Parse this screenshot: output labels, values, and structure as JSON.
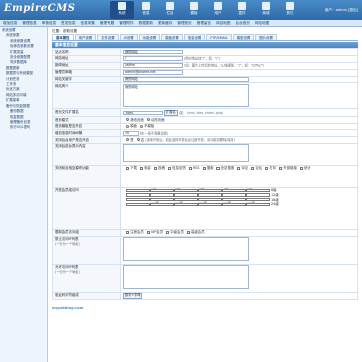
{
  "app": {
    "logo": "EmpireCMS",
    "user_label": "用户：admin [退出]"
  },
  "nav": [
    {
      "label": "系统",
      "icon": "system-icon",
      "active": true
    },
    {
      "label": "信息",
      "icon": "info-icon"
    },
    {
      "label": "栏目",
      "icon": "column-icon"
    },
    {
      "label": "模板",
      "icon": "template-icon"
    },
    {
      "label": "用户",
      "icon": "user-icon"
    },
    {
      "label": "插件",
      "icon": "plugin-icon"
    },
    {
      "label": "商城",
      "icon": "shop-icon"
    },
    {
      "label": "其它",
      "icon": "other-icon"
    }
  ],
  "subnav": [
    "增加信息",
    "管理信息",
    "审核信息",
    "签发信息",
    "信息采集",
    "管理专题",
    "管理附件",
    "数据更新",
    "更新缓存",
    "管理首页",
    "管理留言",
    "网站地图",
    "后台首页",
    "网站地图"
  ],
  "sidebar": [
    {
      "t": "系统设置",
      "l": "l1"
    },
    {
      "t": "系统参数",
      "l": "l2"
    },
    {
      "t": "系统参数设置",
      "l": "l3"
    },
    {
      "t": "伪静态参数设置",
      "l": "l3"
    },
    {
      "t": "扩展变量",
      "l": "l3"
    },
    {
      "t": "安全参数配置",
      "l": "l3"
    },
    {
      "t": "同步数据库",
      "l": "l3"
    },
    {
      "t": "数据更新",
      "l": "l2"
    },
    {
      "t": "数据表与系统模型",
      "l": "l2"
    },
    {
      "t": "计划任务",
      "l": "l2"
    },
    {
      "t": "工作流",
      "l": "l2"
    },
    {
      "t": "优化方案",
      "l": "l2"
    },
    {
      "t": "网站多访问端",
      "l": "l2"
    },
    {
      "t": "扩展菜单",
      "l": "l2"
    },
    {
      "t": "备份与恢复数据",
      "l": "l2"
    },
    {
      "t": "备份数据",
      "l": "l3"
    },
    {
      "t": "恢复数据",
      "l": "l3"
    },
    {
      "t": "管理备份目录",
      "l": "l3"
    },
    {
      "t": "执行SQL语句",
      "l": "l3"
    }
  ],
  "crumb": "位置：参数设置",
  "tabs": [
    "基本属性",
    "用户设置",
    "文件设置",
    "JS设置",
    "功能设置",
    "模板设置",
    "信息设置",
    "FTP/EMAIL",
    "模型设置",
    "图片设置"
  ],
  "section": "基本信息设置",
  "rows": {
    "site_name": {
      "k": "站点名称",
      "v": "我的网站"
    },
    "site_url": {
      "k": "网站地址",
      "v": "/",
      "hint": "(绝对地址加\"/\"，如：\"/\")"
    },
    "news_url": {
      "k": "新闻地址",
      "v": "/d/file/",
      "hint": "(如：图片上传后的地址，以/结尾如：\"/\"，如：\"d/file/\")"
    },
    "admin_email": {
      "k": "管理员邮箱",
      "v": "admin@phome.net"
    },
    "keywords": {
      "k": "网站关键字",
      "v": "我的网站"
    },
    "description": {
      "k": "网站简介",
      "v": "我的网站"
    },
    "index_ext": {
      "k": "首页文件扩展名",
      "v": ".html",
      "sel": "扩展名",
      "hint": "(如：.html,.htm,.shtml,.php)"
    },
    "index_mode": {
      "k": "首页模式",
      "opts": [
        "静态页面",
        "动态页面"
      ]
    },
    "comment_mode": {
      "k": "首页模板是否开启",
      "opts": [
        "模板",
        "不模板"
      ]
    },
    "add_interval": {
      "k": "增加信息时间间隔",
      "v": "10",
      "hint": "秒(一般不需要设置)"
    },
    "open_register": {
      "k": "关闭后台用户是否开启",
      "opts": [
        "是",
        "否"
      ],
      "hint": "(选择开放后，如此选择开放后台注册开放，该功能将删除/保持)"
    },
    "close_msg": {
      "k": "关闭后前台提示内容"
    },
    "open_modules": {
      "k": "关闭前台相应模块功能",
      "boxes": [
        "下载",
        "电影",
        "投稿",
        "信息反馈",
        "RSS",
        "搜索",
        "全站搜索",
        "评论",
        "论坛",
        "打印",
        "外部链接",
        "统计"
      ]
    },
    "open_groups": {
      "k": "开放会员组访问",
      "items": [
        "1级",
        "2级",
        "3级",
        "4级",
        "5级",
        "6级",
        "7级",
        "8级",
        "9级",
        "10级",
        "11级",
        "12级",
        "13级",
        "14级",
        "15级",
        "16级",
        "17级",
        "18级",
        "19级",
        "20级",
        "21级",
        "22级",
        "23级",
        "24级"
      ]
    },
    "fetch_groups": {
      "k": "限制会员访问组",
      "boxes": [
        "注册会员",
        "VIP会员",
        "中级会员",
        "高级会员"
      ]
    },
    "bad_ips": {
      "k": "禁止访问IP列表",
      "hint": "(一行为一个地址)"
    },
    "allow_ips": {
      "k": "允许访问IP列表",
      "hint": "(一行为一个地址)"
    },
    "file_type": {
      "k": "验证码字符组成",
      "v": "数字+字母"
    }
  },
  "watermark": "mypatblog.com"
}
